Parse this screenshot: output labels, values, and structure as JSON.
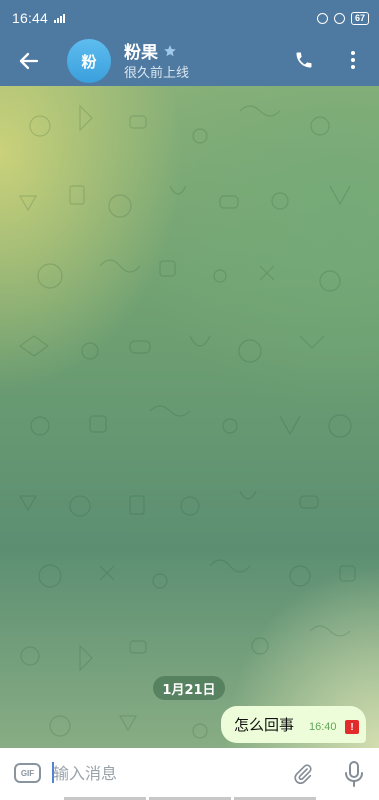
{
  "status_bar": {
    "time": "16:44",
    "battery": "67"
  },
  "header": {
    "avatar_initial": "粉",
    "title": "粉果",
    "status": "很久前上线",
    "icons": [
      "back-arrow-icon",
      "star-icon",
      "phone-icon",
      "more-vert-icon"
    ]
  },
  "chat": {
    "date_label": "1月21日",
    "messages": [
      {
        "text": "怎么回事",
        "time": "16:40",
        "error_mark": "!"
      }
    ]
  },
  "input_bar": {
    "gif_label": "GIF",
    "placeholder": "输入消息",
    "icons": [
      "gif-icon",
      "attach-icon",
      "mic-icon"
    ]
  },
  "colors": {
    "header": "#4e79a0",
    "bubble": "#eefdd9",
    "bubble_time": "#62a55a",
    "error": "#e42b2b",
    "avatar": "#4aaee8"
  }
}
